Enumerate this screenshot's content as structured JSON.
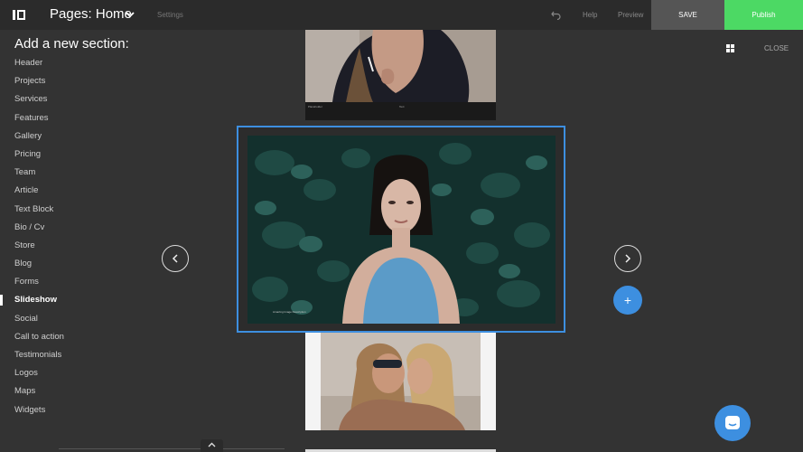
{
  "topbar": {
    "page_label": "Pages: Home",
    "settings_label": "Settings",
    "help_label": "Help",
    "preview_label": "Preview",
    "save_label": "SAVE",
    "publish_label": "Publish",
    "colors": {
      "save_bg": "#555555",
      "publish_bg": "#4cd964"
    }
  },
  "sidebar": {
    "title": "Add a new section:",
    "items": [
      {
        "label": "Header"
      },
      {
        "label": "Projects"
      },
      {
        "label": "Services"
      },
      {
        "label": "Features"
      },
      {
        "label": "Gallery"
      },
      {
        "label": "Pricing"
      },
      {
        "label": "Team"
      },
      {
        "label": "Article"
      },
      {
        "label": "Text Block"
      },
      {
        "label": "Bio / Cv"
      },
      {
        "label": "Store"
      },
      {
        "label": "Blog"
      },
      {
        "label": "Forms"
      },
      {
        "label": "Slideshow",
        "active": true
      },
      {
        "label": "Social"
      },
      {
        "label": "Call to action"
      },
      {
        "label": "Testimonials"
      },
      {
        "label": "Logos"
      },
      {
        "label": "Maps"
      },
      {
        "label": "Widgets"
      }
    ]
  },
  "controls": {
    "close_label": "CLOSE",
    "add_label": "+",
    "accent": "#3d8fe0"
  },
  "slides": {
    "top_caption_left": "Placeholder",
    "top_caption_right": "Text",
    "main_caption": "Amazing Image Description"
  },
  "icons": [
    "sidebar-toggle-icon",
    "chevron-down-icon",
    "undo-icon",
    "grid-icon",
    "chevron-left-icon",
    "chevron-right-icon",
    "plus-icon",
    "chat-icon",
    "chevron-up-icon"
  ]
}
